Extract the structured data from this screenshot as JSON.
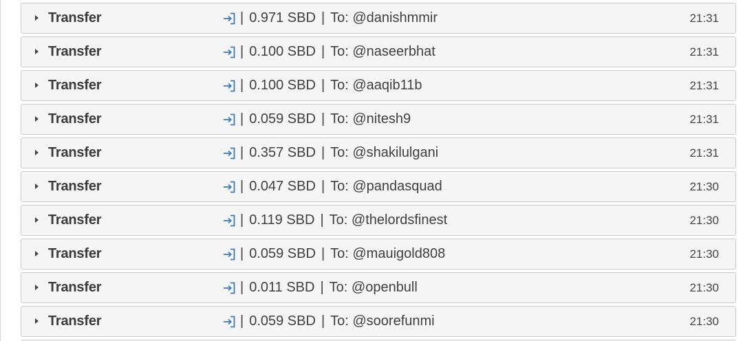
{
  "rows": [
    {
      "type": "Transfer",
      "amount": "0.971 SBD",
      "to": "To: @danishmmir",
      "time": "21:31"
    },
    {
      "type": "Transfer",
      "amount": "0.100 SBD",
      "to": "To: @naseerbhat",
      "time": "21:31"
    },
    {
      "type": "Transfer",
      "amount": "0.100 SBD",
      "to": "To: @aaqib11b",
      "time": "21:31"
    },
    {
      "type": "Transfer",
      "amount": "0.059 SBD",
      "to": "To: @nitesh9",
      "time": "21:31"
    },
    {
      "type": "Transfer",
      "amount": "0.357 SBD",
      "to": "To: @shakilulgani",
      "time": "21:31"
    },
    {
      "type": "Transfer",
      "amount": "0.047 SBD",
      "to": "To: @pandasquad",
      "time": "21:30"
    },
    {
      "type": "Transfer",
      "amount": "0.119 SBD",
      "to": "To: @thelordsfinest",
      "time": "21:30"
    },
    {
      "type": "Transfer",
      "amount": "0.059 SBD",
      "to": "To: @mauigold808",
      "time": "21:30"
    },
    {
      "type": "Transfer",
      "amount": "0.011 SBD",
      "to": "To: @openbull",
      "time": "21:30"
    },
    {
      "type": "Transfer",
      "amount": "0.059 SBD",
      "to": "To: @soorefunmi",
      "time": "21:30"
    }
  ],
  "separator": "|",
  "icon": "sign-in-icon",
  "colors": {
    "icon": "#3d7ab8",
    "row_background": "#f5f5f5",
    "row_border": "#c9c9c9",
    "text": "#3f3f3f"
  }
}
